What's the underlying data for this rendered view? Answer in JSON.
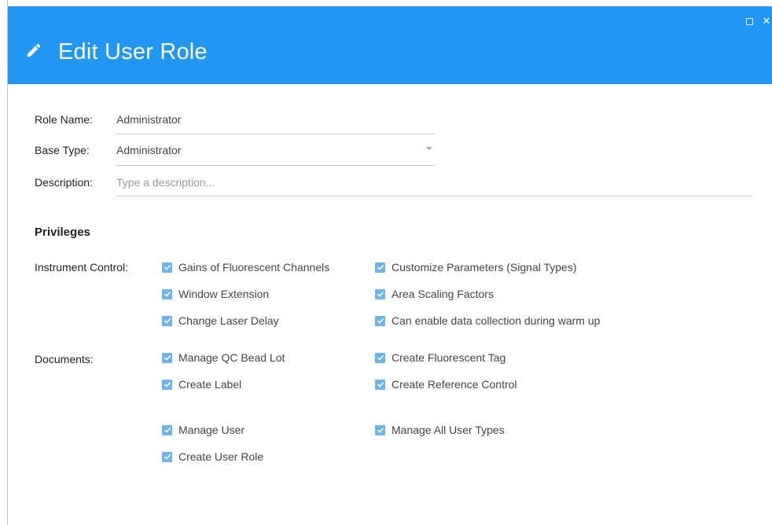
{
  "dialog": {
    "title": "Edit User Role",
    "accent_color": "#2196f3",
    "checkbox_color": "#6cb4ee",
    "window_controls": {
      "maximize_icon": "maximize-icon",
      "close_icon": "close-icon",
      "close_glyph": "✕"
    }
  },
  "form": {
    "role_name": {
      "label": "Role Name:",
      "value": "Administrator"
    },
    "base_type": {
      "label": "Base Type:",
      "value": "Administrator"
    },
    "description": {
      "label": "Description:",
      "value": "",
      "placeholder": "Type a description..."
    }
  },
  "privileges": {
    "title": "Privileges",
    "groups": {
      "instrument_control": {
        "label": "Instrument Control:",
        "items": [
          {
            "label": "Gains of Fluorescent Channels",
            "checked": true
          },
          {
            "label": "Customize Parameters (Signal Types)",
            "checked": true
          },
          {
            "label": "Window Extension",
            "checked": true
          },
          {
            "label": "Area Scaling Factors",
            "checked": true
          },
          {
            "label": "Change Laser Delay",
            "checked": true
          },
          {
            "label": "Can enable data collection during warm up",
            "checked": true
          }
        ]
      },
      "documents": {
        "label": "Documents:",
        "items": [
          {
            "label": "Manage QC Bead Lot",
            "checked": true
          },
          {
            "label": "Create Fluorescent Tag",
            "checked": true
          },
          {
            "label": "Create Label",
            "checked": true
          },
          {
            "label": "Create Reference Control",
            "checked": true
          }
        ]
      },
      "users": {
        "label": "",
        "items": [
          {
            "label": "Manage User",
            "checked": true
          },
          {
            "label": "Manage All User Types",
            "checked": true
          },
          {
            "label": "Create User Role",
            "checked": true
          }
        ]
      }
    }
  }
}
